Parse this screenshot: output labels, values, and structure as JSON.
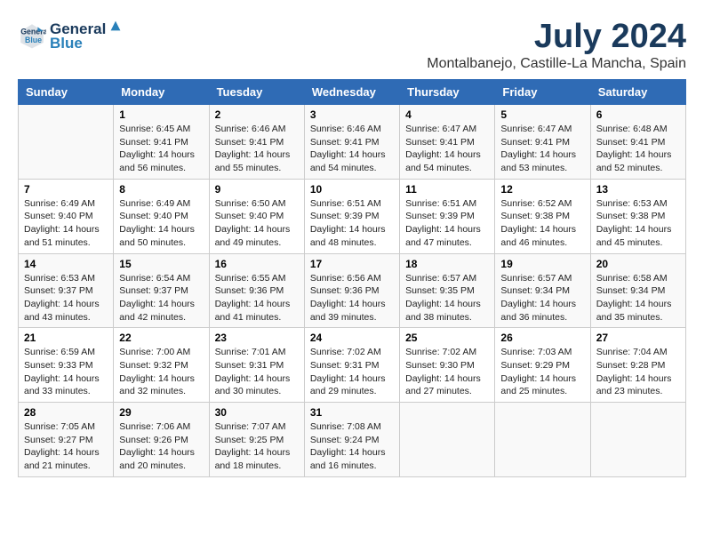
{
  "header": {
    "logo_line1": "General",
    "logo_line2": "Blue",
    "month_year": "July 2024",
    "location": "Montalbanejo, Castille-La Mancha, Spain"
  },
  "days_of_week": [
    "Sunday",
    "Monday",
    "Tuesday",
    "Wednesday",
    "Thursday",
    "Friday",
    "Saturday"
  ],
  "weeks": [
    [
      {
        "day": "",
        "content": ""
      },
      {
        "day": "1",
        "content": "Sunrise: 6:45 AM\nSunset: 9:41 PM\nDaylight: 14 hours\nand 56 minutes."
      },
      {
        "day": "2",
        "content": "Sunrise: 6:46 AM\nSunset: 9:41 PM\nDaylight: 14 hours\nand 55 minutes."
      },
      {
        "day": "3",
        "content": "Sunrise: 6:46 AM\nSunset: 9:41 PM\nDaylight: 14 hours\nand 54 minutes."
      },
      {
        "day": "4",
        "content": "Sunrise: 6:47 AM\nSunset: 9:41 PM\nDaylight: 14 hours\nand 54 minutes."
      },
      {
        "day": "5",
        "content": "Sunrise: 6:47 AM\nSunset: 9:41 PM\nDaylight: 14 hours\nand 53 minutes."
      },
      {
        "day": "6",
        "content": "Sunrise: 6:48 AM\nSunset: 9:41 PM\nDaylight: 14 hours\nand 52 minutes."
      }
    ],
    [
      {
        "day": "7",
        "content": "Sunrise: 6:49 AM\nSunset: 9:40 PM\nDaylight: 14 hours\nand 51 minutes."
      },
      {
        "day": "8",
        "content": "Sunrise: 6:49 AM\nSunset: 9:40 PM\nDaylight: 14 hours\nand 50 minutes."
      },
      {
        "day": "9",
        "content": "Sunrise: 6:50 AM\nSunset: 9:40 PM\nDaylight: 14 hours\nand 49 minutes."
      },
      {
        "day": "10",
        "content": "Sunrise: 6:51 AM\nSunset: 9:39 PM\nDaylight: 14 hours\nand 48 minutes."
      },
      {
        "day": "11",
        "content": "Sunrise: 6:51 AM\nSunset: 9:39 PM\nDaylight: 14 hours\nand 47 minutes."
      },
      {
        "day": "12",
        "content": "Sunrise: 6:52 AM\nSunset: 9:38 PM\nDaylight: 14 hours\nand 46 minutes."
      },
      {
        "day": "13",
        "content": "Sunrise: 6:53 AM\nSunset: 9:38 PM\nDaylight: 14 hours\nand 45 minutes."
      }
    ],
    [
      {
        "day": "14",
        "content": "Sunrise: 6:53 AM\nSunset: 9:37 PM\nDaylight: 14 hours\nand 43 minutes."
      },
      {
        "day": "15",
        "content": "Sunrise: 6:54 AM\nSunset: 9:37 PM\nDaylight: 14 hours\nand 42 minutes."
      },
      {
        "day": "16",
        "content": "Sunrise: 6:55 AM\nSunset: 9:36 PM\nDaylight: 14 hours\nand 41 minutes."
      },
      {
        "day": "17",
        "content": "Sunrise: 6:56 AM\nSunset: 9:36 PM\nDaylight: 14 hours\nand 39 minutes."
      },
      {
        "day": "18",
        "content": "Sunrise: 6:57 AM\nSunset: 9:35 PM\nDaylight: 14 hours\nand 38 minutes."
      },
      {
        "day": "19",
        "content": "Sunrise: 6:57 AM\nSunset: 9:34 PM\nDaylight: 14 hours\nand 36 minutes."
      },
      {
        "day": "20",
        "content": "Sunrise: 6:58 AM\nSunset: 9:34 PM\nDaylight: 14 hours\nand 35 minutes."
      }
    ],
    [
      {
        "day": "21",
        "content": "Sunrise: 6:59 AM\nSunset: 9:33 PM\nDaylight: 14 hours\nand 33 minutes."
      },
      {
        "day": "22",
        "content": "Sunrise: 7:00 AM\nSunset: 9:32 PM\nDaylight: 14 hours\nand 32 minutes."
      },
      {
        "day": "23",
        "content": "Sunrise: 7:01 AM\nSunset: 9:31 PM\nDaylight: 14 hours\nand 30 minutes."
      },
      {
        "day": "24",
        "content": "Sunrise: 7:02 AM\nSunset: 9:31 PM\nDaylight: 14 hours\nand 29 minutes."
      },
      {
        "day": "25",
        "content": "Sunrise: 7:02 AM\nSunset: 9:30 PM\nDaylight: 14 hours\nand 27 minutes."
      },
      {
        "day": "26",
        "content": "Sunrise: 7:03 AM\nSunset: 9:29 PM\nDaylight: 14 hours\nand 25 minutes."
      },
      {
        "day": "27",
        "content": "Sunrise: 7:04 AM\nSunset: 9:28 PM\nDaylight: 14 hours\nand 23 minutes."
      }
    ],
    [
      {
        "day": "28",
        "content": "Sunrise: 7:05 AM\nSunset: 9:27 PM\nDaylight: 14 hours\nand 21 minutes."
      },
      {
        "day": "29",
        "content": "Sunrise: 7:06 AM\nSunset: 9:26 PM\nDaylight: 14 hours\nand 20 minutes."
      },
      {
        "day": "30",
        "content": "Sunrise: 7:07 AM\nSunset: 9:25 PM\nDaylight: 14 hours\nand 18 minutes."
      },
      {
        "day": "31",
        "content": "Sunrise: 7:08 AM\nSunset: 9:24 PM\nDaylight: 14 hours\nand 16 minutes."
      },
      {
        "day": "",
        "content": ""
      },
      {
        "day": "",
        "content": ""
      },
      {
        "day": "",
        "content": ""
      }
    ]
  ]
}
